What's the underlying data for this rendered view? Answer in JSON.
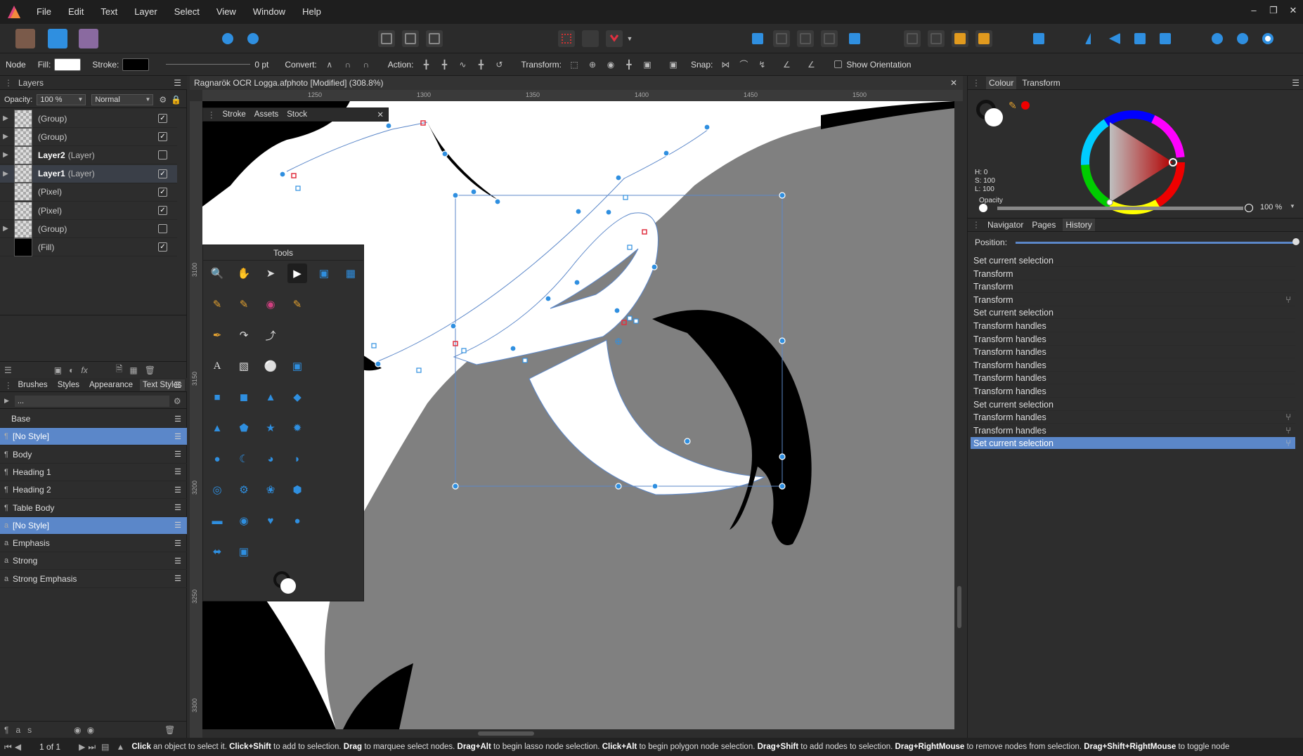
{
  "menu": {
    "items": [
      "File",
      "Edit",
      "Text",
      "Layer",
      "Select",
      "View",
      "Window",
      "Help"
    ]
  },
  "context_bar": {
    "node_label": "Node",
    "fill_label": "Fill:",
    "stroke_label": "Stroke:",
    "stroke_width": "0 pt",
    "convert_label": "Convert:",
    "action_label": "Action:",
    "transform_label": "Transform:",
    "snap_label": "Snap:",
    "show_orientation": "Show Orientation",
    "fill_color": "#ffffff",
    "stroke_color": "#000000"
  },
  "layers_panel": {
    "tab": "Layers",
    "opacity_label": "Opacity:",
    "opacity_value": "100 %",
    "blend_mode": "Normal",
    "rows": [
      {
        "name": "(Group)",
        "bold": false,
        "checked": true,
        "has_arrow": true
      },
      {
        "name": "(Group)",
        "bold": false,
        "checked": true,
        "has_arrow": true
      },
      {
        "name": "Layer2",
        "type": "(Layer)",
        "bold": true,
        "checked": false,
        "has_arrow": true
      },
      {
        "name": "Layer1",
        "type": "(Layer)",
        "bold": true,
        "checked": true,
        "has_arrow": true
      },
      {
        "name": "(Pixel)",
        "bold": false,
        "checked": true,
        "has_arrow": false
      },
      {
        "name": "(Pixel)",
        "bold": false,
        "checked": true,
        "has_arrow": false
      },
      {
        "name": "(Group)",
        "bold": false,
        "checked": false,
        "has_arrow": true
      },
      {
        "name": "(Fill)",
        "bold": false,
        "checked": true,
        "has_arrow": false
      }
    ]
  },
  "styles_panel": {
    "tabs": [
      "Brushes",
      "Styles",
      "Appearance",
      "Text Styles"
    ],
    "active_tab": "Text Styles",
    "search_value": "...",
    "rows": [
      {
        "name": "Base",
        "type": "group",
        "selected": false
      },
      {
        "name": "[No Style]",
        "type": "paragraph",
        "selected": true
      },
      {
        "name": "Body",
        "type": "paragraph",
        "selected": false
      },
      {
        "name": "Heading 1",
        "type": "paragraph",
        "selected": false
      },
      {
        "name": "Heading 2",
        "type": "paragraph",
        "selected": false
      },
      {
        "name": "Table Body",
        "type": "paragraph",
        "selected": false
      },
      {
        "name": "[No Style]",
        "type": "character",
        "selected": true
      },
      {
        "name": "Emphasis",
        "type": "character",
        "selected": false
      },
      {
        "name": "Strong",
        "type": "character",
        "selected": false
      },
      {
        "name": "Strong Emphasis",
        "type": "character",
        "selected": false
      }
    ],
    "pagination": "1 of 1"
  },
  "document": {
    "title": "Ragnarök OCR Logga.afphoto [Modified] (308.8%)",
    "ruler_labels": [
      "1250",
      "1300",
      "1350",
      "1400",
      "1450",
      "1500"
    ],
    "vruler_labels": [
      "3100",
      "3150",
      "3200",
      "3250",
      "3300"
    ]
  },
  "floating_tabs": {
    "tabs": [
      "Stroke",
      "Assets",
      "Stock"
    ]
  },
  "tools_panel": {
    "title": "Tools"
  },
  "colour_panel": {
    "tabs": [
      "Colour",
      "Transform"
    ],
    "active": "Colour",
    "h": "H: 0",
    "s": "S: 100",
    "l": "L: 100",
    "opacity_label": "Opacity",
    "opacity_value": "100 %"
  },
  "history_panel": {
    "tabs": [
      "Navigator",
      "Pages",
      "History"
    ],
    "active": "History",
    "position_label": "Position:",
    "rows": [
      {
        "label": "Set current selection",
        "fork": false,
        "selected": false
      },
      {
        "label": "Transform",
        "fork": false,
        "selected": false
      },
      {
        "label": "Transform",
        "fork": false,
        "selected": false
      },
      {
        "label": "Transform",
        "fork": true,
        "selected": false
      },
      {
        "label": "Set current selection",
        "fork": false,
        "selected": false
      },
      {
        "label": "Transform handles",
        "fork": false,
        "selected": false
      },
      {
        "label": "Transform handles",
        "fork": false,
        "selected": false
      },
      {
        "label": "Transform handles",
        "fork": false,
        "selected": false
      },
      {
        "label": "Transform handles",
        "fork": false,
        "selected": false
      },
      {
        "label": "Transform handles",
        "fork": false,
        "selected": false
      },
      {
        "label": "Transform handles",
        "fork": false,
        "selected": false
      },
      {
        "label": "Set current selection",
        "fork": false,
        "selected": false
      },
      {
        "label": "Transform handles",
        "fork": true,
        "selected": false
      },
      {
        "label": "Transform handles",
        "fork": true,
        "selected": false
      },
      {
        "label": "Set current selection",
        "fork": true,
        "selected": true
      }
    ]
  },
  "statusbar": {
    "page": "1 of 1",
    "segments": [
      {
        "t": "Click",
        "b": true
      },
      {
        "t": " an object to select it. ",
        "b": false
      },
      {
        "t": "Click+Shift",
        "b": true
      },
      {
        "t": " to add to selection. ",
        "b": false
      },
      {
        "t": "Drag",
        "b": true
      },
      {
        "t": " to marquee select nodes. ",
        "b": false
      },
      {
        "t": "Drag+Alt",
        "b": true
      },
      {
        "t": " to begin lasso node selection. ",
        "b": false
      },
      {
        "t": "Click+Alt",
        "b": true
      },
      {
        "t": " to begin polygon node selection. ",
        "b": false
      },
      {
        "t": "Drag+Shift",
        "b": true
      },
      {
        "t": " to add nodes to selection. ",
        "b": false
      },
      {
        "t": "Drag+RightMouse",
        "b": true
      },
      {
        "t": " to remove nodes from selection. ",
        "b": false
      },
      {
        "t": "Drag+Shift+RightMouse",
        "b": true
      },
      {
        "t": " to toggle node",
        "b": false
      }
    ]
  }
}
